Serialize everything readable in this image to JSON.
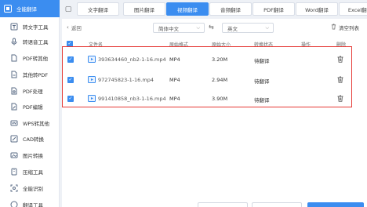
{
  "sidebar": {
    "active": "全能翻译",
    "items": [
      {
        "label": "转文字工具",
        "icon": "text-tool-icon"
      },
      {
        "label": "转语音工具",
        "icon": "voice-tool-icon"
      },
      {
        "label": "PDF转其他",
        "icon": "pdf-convert-icon"
      },
      {
        "label": "其他转PDF",
        "icon": "to-pdf-icon"
      },
      {
        "label": "PDF处理",
        "icon": "pdf-process-icon"
      },
      {
        "label": "PDF编辑",
        "icon": "pdf-edit-icon"
      },
      {
        "label": "WPS转其他",
        "icon": "wps-icon"
      },
      {
        "label": "CAD转换",
        "icon": "cad-icon"
      },
      {
        "label": "图片转换",
        "icon": "image-icon"
      },
      {
        "label": "压缩工具",
        "icon": "compress-icon"
      },
      {
        "label": "全能识别",
        "icon": "recognize-icon"
      },
      {
        "label": "翻译工具",
        "icon": "translate-icon"
      }
    ]
  },
  "tabs": [
    {
      "label": "文字翻译",
      "active": false
    },
    {
      "label": "图片翻译",
      "active": false
    },
    {
      "label": "视频翻译",
      "active": true
    },
    {
      "label": "音频翻译",
      "active": false
    },
    {
      "label": "PDF翻译",
      "active": false
    },
    {
      "label": "Word翻译",
      "active": false
    },
    {
      "label": "Excel翻译",
      "active": false
    }
  ],
  "toolbar": {
    "back_label": "返回",
    "source_lang": "简体中文",
    "target_lang": "英文",
    "clear_label": "清空列表"
  },
  "table": {
    "headers": {
      "name": "文件名",
      "format": "原始格式",
      "size": "原始大小",
      "status": "转换状态",
      "action": "操作",
      "delete": "删除"
    },
    "rows": [
      {
        "name": "393634460_nb2-1-16.mp4",
        "format": "MP4",
        "size": "3.20M",
        "status": "待翻译"
      },
      {
        "name": "972745823-1-16.mp4",
        "format": "MP4",
        "size": "2.94M",
        "status": "待翻译"
      },
      {
        "name": "991410858_nb3-1-16.mp4",
        "format": "MP4",
        "size": "3.90M",
        "status": "待翻译"
      }
    ]
  },
  "colors": {
    "accent": "#3b8df0",
    "highlight_border": "#e53935"
  }
}
